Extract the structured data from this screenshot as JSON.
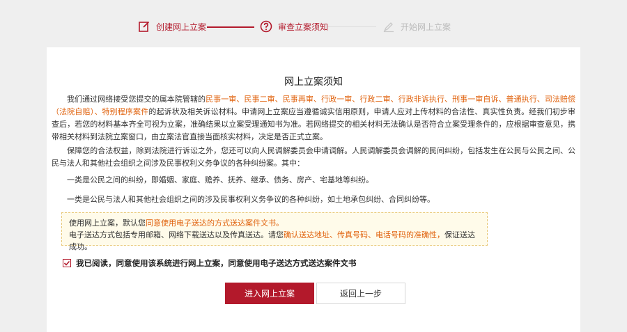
{
  "steps": [
    {
      "label": "创建网上立案",
      "icon": "edit-icon",
      "state": "done"
    },
    {
      "label": "审查立案须知",
      "icon": "question-icon",
      "state": "active"
    },
    {
      "label": "开始网上立案",
      "icon": "pen-icon",
      "state": "pending"
    }
  ],
  "colors": {
    "accent": "#b3192b",
    "highlight": "#e0620d",
    "notice_bg": "#fffbea"
  },
  "notice_title": "网上立案须知",
  "para1": {
    "pre": "我们通过网络接受您提交的属本院管辖的",
    "cases": "民事一审、民事二审、民事再审、行政一审、行政二审、行政非诉执行、刑事一审自诉、普通执行、司法赔偿（法院自赔）、特别程序案件",
    "post": "的起诉状及相关诉讼材料。申请网上立案应当遵循诚实信用原则，申请人应对上传材料的合法性、真实性负责。经我们初步审查后，若您的材料基本齐全可视为立案，准确结果以立案受理通知书为准。若网络提交的相关材料无法确认是否符合立案受理条件的，应根据审查意见，携带相关材料到法院立案窗口，由立案法官直接当面核实材料，决定是否正式立案。"
  },
  "para2": "保障您的合法权益，除到法院进行诉讼之外，您还可以向人民调解委员会申请调解。人民调解委员会调解的民间纠纷，包括发生在公民与公民之间、公民与法人和其他社会组织之间涉及民事权利义务争议的各种纠纷案。其中：",
  "para3": "一类是公民之间的纠纷，即婚姻、家庭、赡养、抚养、继承、债务、房产、宅基地等纠纷。",
  "para4": "一类是公民与法人和其他社会组织之间的涉及民事权利义务争议的各种纠纷，如土地承包纠纷、合同纠纷等。",
  "notice": {
    "line1_pre": "使用网上立案，默认您",
    "line1_hl": "同意使用电子送达的方式送达案件文书。",
    "line2_pre": "电子送达方式包括专用邮箱、网络下载送达以及传真送达。请您",
    "line2_hl": "确认送达地址、传真号码、电话号码的准确性，",
    "line2_post": "保证送达成功。"
  },
  "agree": {
    "checked": true,
    "label": "我已阅读，同意使用该系统进行网上立案，同意使用电子送达方式送达案件文书"
  },
  "buttons": {
    "enter": "进入网上立案",
    "back": "返回上一步"
  }
}
